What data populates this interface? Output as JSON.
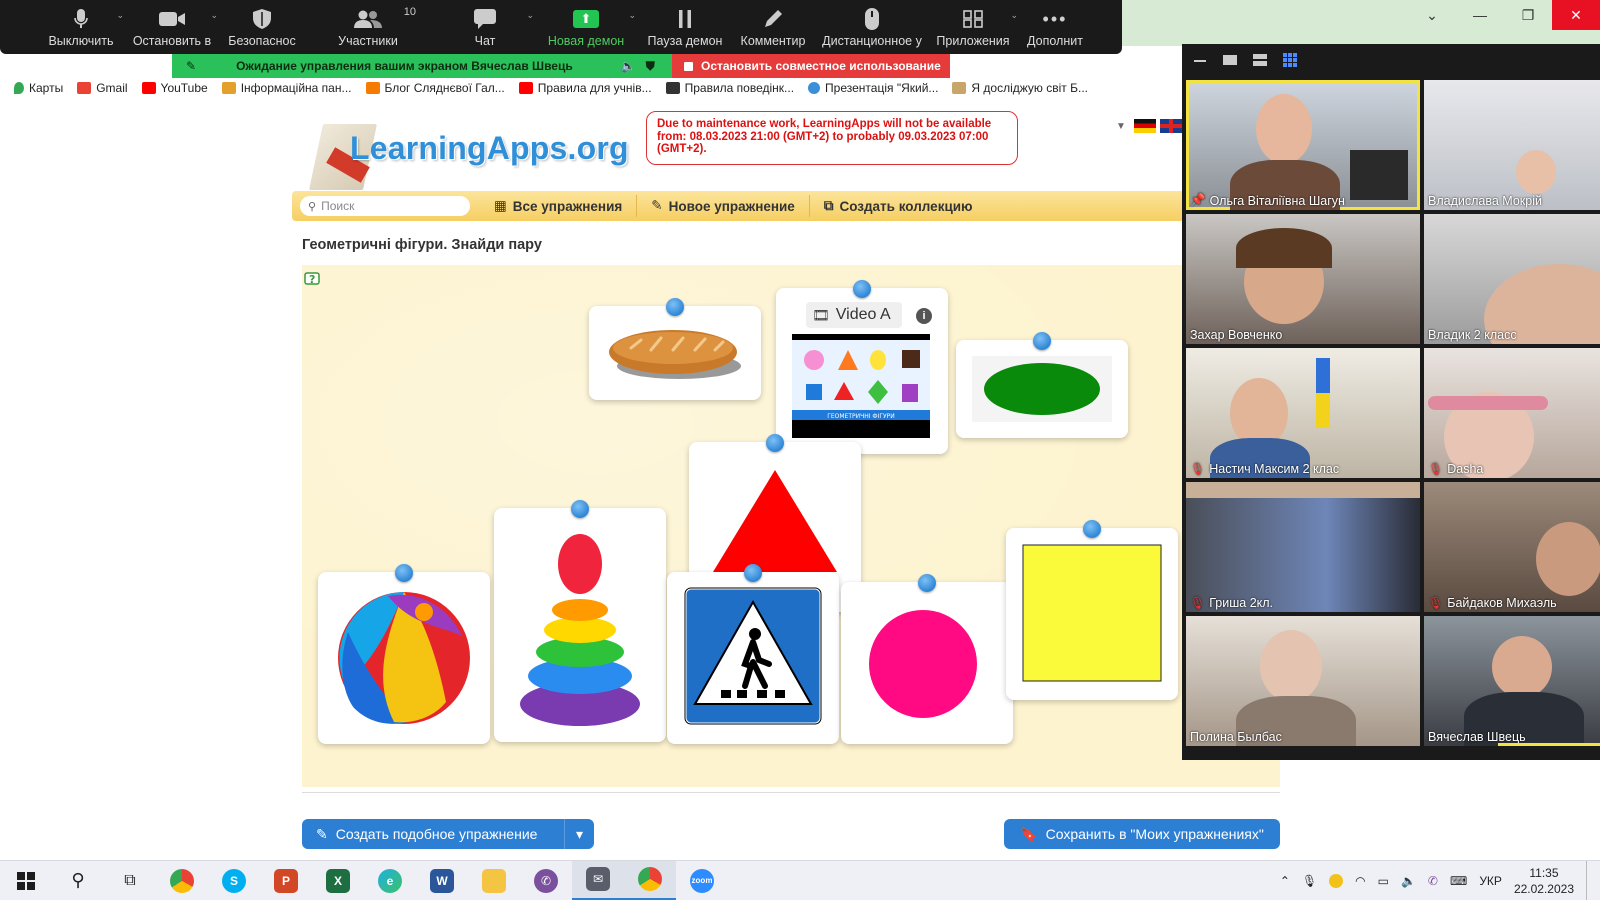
{
  "zoom_toolbar": {
    "items": [
      {
        "label": "Выключить"
      },
      {
        "label": "Остановить в"
      },
      {
        "label": "Безопаснос"
      },
      {
        "label": "Участники",
        "count": "10"
      },
      {
        "label": "Чат"
      },
      {
        "label": "Новая демон"
      },
      {
        "label": "Пауза демон"
      },
      {
        "label": "Комментир"
      },
      {
        "label": "Дистанционное у"
      },
      {
        "label": "Приложения"
      },
      {
        "label": "Дополнит"
      }
    ]
  },
  "share_bar": {
    "waiting_text": "Ожидание управления вашим экраном Вячеслав Швець",
    "stop_label": "Остановить совместное использование"
  },
  "bookmarks": [
    {
      "label": "Карты",
      "color": "#34a853"
    },
    {
      "label": "Gmail",
      "color": "#ea4335"
    },
    {
      "label": "YouTube",
      "color": "#ff0000"
    },
    {
      "label": "Інформаційна пан...",
      "color": "#e3a02a"
    },
    {
      "label": "Блог Сляднєвої Гал...",
      "color": "#f57c00"
    },
    {
      "label": "Правила для учнів...",
      "color": "#ff0000"
    },
    {
      "label": "Правила поведінк...",
      "color": "#333333"
    },
    {
      "label": "Презентація \"Який...",
      "color": "#3b8fd8"
    },
    {
      "label": "Я досліджую світ Б...",
      "color": "#8a6a3a"
    }
  ],
  "learningapps": {
    "logo": "LearningApps.org",
    "maintenance": "Due to maintenance work, LearningApps will not be available from: 08.03.2023 21:00 (GMT+2) to probably 09.03.2023 07:00 (GMT+2).",
    "search_placeholder": "Поиск",
    "nav": [
      "Все упражнения",
      "Новое упражнение",
      "Создать коллекцию"
    ],
    "exercise_title": "Геометричні фігури. Знайди пару",
    "video_label": "Video A",
    "video_caption": "ГЕОМЕТРИЧНІ ФІГУРИ",
    "cards": [
      {
        "name": "bread-card",
        "icon": "bread"
      },
      {
        "name": "video-card",
        "icon": "video"
      },
      {
        "name": "green-oval-card",
        "icon": "oval"
      },
      {
        "name": "red-triangle-card",
        "icon": "triangle"
      },
      {
        "name": "pyramid-toy-card",
        "icon": "pyramid"
      },
      {
        "name": "ball-card",
        "icon": "ball"
      },
      {
        "name": "crosswalk-sign-card",
        "icon": "crosswalk"
      },
      {
        "name": "pink-circle-card",
        "icon": "circle"
      },
      {
        "name": "yellow-square-card",
        "icon": "square"
      }
    ],
    "btn_similar": "Создать подобное упражнение",
    "btn_save": "Сохранить в \"Моих упражнениях\""
  },
  "gallery": {
    "participants": [
      {
        "name": "Ольга Віталіївна Шагун",
        "pinned": true,
        "muted": false
      },
      {
        "name": "Владислава Мокрій",
        "muted": false
      },
      {
        "name": "Захар Вовченко",
        "muted": false
      },
      {
        "name": "Владик 2 класс",
        "muted": false
      },
      {
        "name": "Настич Максим 2 клас",
        "muted": true
      },
      {
        "name": "Dasha",
        "muted": true
      },
      {
        "name": "Гриша 2кл.",
        "muted": true
      },
      {
        "name": "Байдаков Михаэль",
        "muted": true
      },
      {
        "name": "Полина Былбас",
        "muted": false
      },
      {
        "name": "Вячеслав Швець",
        "muted": false
      }
    ]
  },
  "taskbar": {
    "language": "УКР",
    "time": "11:35",
    "date": "22.02.2023"
  },
  "colors": {
    "zoom_dark": "#1a1a1a",
    "share_green": "#2bc15a",
    "stop_red": "#e53b3b",
    "la_blue": "#2f8fd8",
    "active_speaker": "#f2e342"
  }
}
